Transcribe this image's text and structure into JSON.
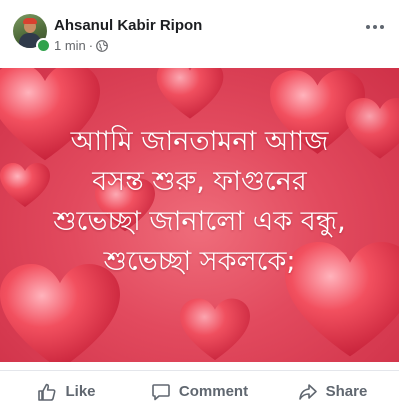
{
  "post": {
    "author": "Ahsanul Kabir Ripon",
    "time": "1 min",
    "separator": "·",
    "privacy_icon": "globe-icon",
    "more_icon": "ellipsis-icon"
  },
  "image": {
    "lines": [
      "আামি জানতামনা আাজ",
      "বসন্ত শুরু, ফাগুনের",
      "শুভেচ্ছা জানালো এক বন্ধু,",
      "শুভেচ্ছা সকলকে;"
    ]
  },
  "actions": {
    "like_label": "Like",
    "comment_label": "Comment",
    "share_label": "Share"
  },
  "colors": {
    "text_dark": "#1c1e21",
    "meta_gray": "#65676b",
    "online_green": "#31a24c",
    "image_pink": "#e24a5e"
  }
}
